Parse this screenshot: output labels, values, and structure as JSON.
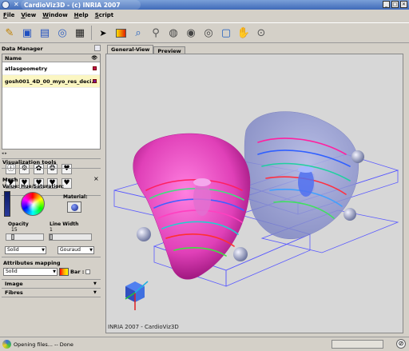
{
  "window": {
    "title": "CardioViz3D - (c) INRIA 2007"
  },
  "menu": [
    "File",
    "View",
    "Window",
    "Help",
    "Script"
  ],
  "toolbar": {
    "icons": [
      "magic-wand-icon",
      "open-folder-icon",
      "save-icon",
      "capture-icon",
      "film-icon",
      "pointer-icon",
      "color-square-icon",
      "zoom-icon",
      "ruler-icon",
      "brain-view-1-icon",
      "brain-view-2-icon",
      "brain-view-3-icon",
      "fit-view-icon",
      "hand-icon",
      "camera-icon"
    ]
  },
  "data_manager": {
    "title": "Data Manager",
    "columns": [
      "Name"
    ],
    "rows": [
      "atlasgeometry",
      "gosh001_4D_00_myo_res_deci..."
    ]
  },
  "tools": {
    "visualization_title": "Visualization tools",
    "mesh_title": "Mesh",
    "value_label": "Value: Hue/Saturation:",
    "material_label": "Material:",
    "opacity_label": "Opacity",
    "opacity_value": "15",
    "linewidth_label": "Line Width",
    "linewidth_value": "1",
    "shading": "Gouraud",
    "render_mode": "Solid",
    "attributes_title": "Attributes mapping",
    "attr_mode": "Solid",
    "bar_label": "Bar :",
    "sections": [
      "Image",
      "Fibres"
    ]
  },
  "viewer": {
    "tabs": [
      "General-View",
      "Preview"
    ],
    "caption": "INRIA 2007 - CardioViz3D"
  },
  "status": {
    "text": "Opening files... -- Done"
  }
}
